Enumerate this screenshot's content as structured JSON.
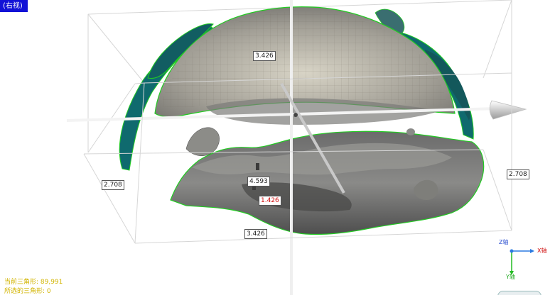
{
  "view": {
    "label": "(右视)"
  },
  "dimensions": {
    "top": "3.426",
    "left": "2.708",
    "right": "2.708",
    "bottom": "3.426",
    "center": "4.593",
    "center_low": "1.426"
  },
  "status": {
    "current_triangles": "当前三角形: 89,991",
    "selected_triangles": "所选的三角形: 0"
  },
  "axes": {
    "z": "Z轴",
    "x": "X轴",
    "y": "Y轴"
  },
  "colors": {
    "view_tag_bg": "#1212d6",
    "status_text": "#d2b400",
    "outline_green": "#22cc22",
    "teal": "#0f6a6e"
  }
}
